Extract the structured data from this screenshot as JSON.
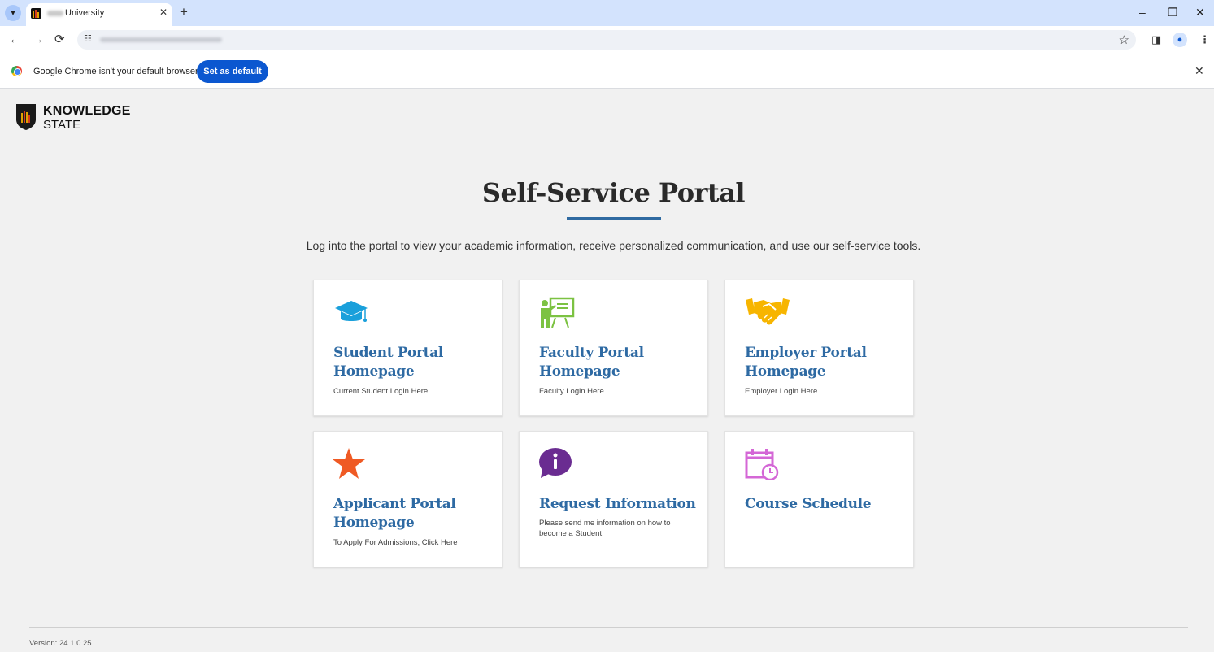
{
  "browser": {
    "tab": {
      "title": "University",
      "close": "✕"
    },
    "new_tab": "+",
    "window_controls": {
      "minimize": "–",
      "restore": "❐",
      "close": "✕"
    },
    "nav": {
      "back": "←",
      "forward": "→",
      "reload": "⟳"
    },
    "infobar": {
      "message": "Google Chrome isn't your default browser",
      "button": "Set as default",
      "close": "✕"
    },
    "icons": [
      "tab-search-icon",
      "favicon-icon",
      "site-settings-icon",
      "bookmark-star-icon",
      "side-panel-icon",
      "profile-icon",
      "menu-icon",
      "chrome-logo-icon"
    ]
  },
  "logo": {
    "line1": "KNOWLEDGE",
    "line2": "STATE"
  },
  "page": {
    "title": "Self-Service Portal",
    "intro": "Log into the portal to view your academic information, receive personalized communication, and use our self-service tools."
  },
  "cards": [
    {
      "title": "Student Portal Homepage",
      "description": "Current Student Login Here",
      "icon": "graduation-cap-icon",
      "color": "#1aa0db"
    },
    {
      "title": "Faculty Portal Homepage",
      "description": "Faculty Login Here",
      "icon": "teacher-board-icon",
      "color": "#7cc242"
    },
    {
      "title": "Employer Portal Homepage",
      "description": "Employer Login Here",
      "icon": "handshake-icon",
      "color": "#f7b500"
    },
    {
      "title": "Applicant Portal Homepage",
      "description": "To Apply For Admissions, Click Here",
      "icon": "star-icon",
      "color": "#ef5a24"
    },
    {
      "title": "Request Information",
      "description": "Please send me information on how to become a Student",
      "icon": "info-bubble-icon",
      "color": "#6a2c91"
    },
    {
      "title": "Course Schedule",
      "description": "",
      "icon": "calendar-clock-icon",
      "color": "#d467d6"
    }
  ],
  "colors": {
    "accent": "#2e6aa3",
    "chrome_button": "#0b57d0",
    "tabstrip": "#d3e3fd"
  },
  "footer": {
    "version": "Version: 24.1.0.25"
  }
}
